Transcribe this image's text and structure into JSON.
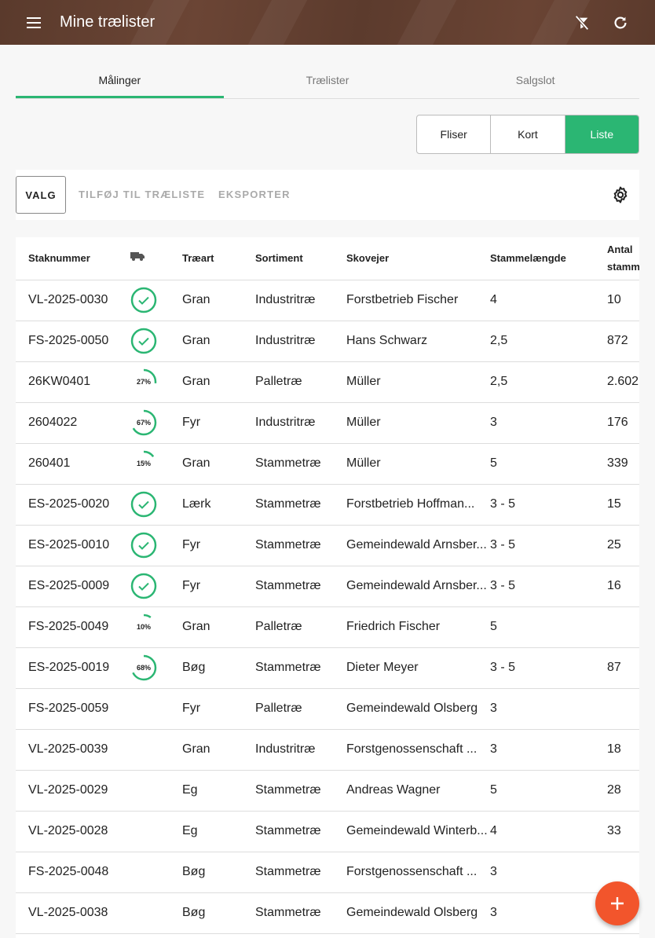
{
  "appbar": {
    "title": "Mine trælister",
    "menu_icon": "menu-icon",
    "filter_icon": "filter-off-icon",
    "refresh_icon": "refresh-icon"
  },
  "tabs": [
    {
      "label": "Målinger",
      "active": true
    },
    {
      "label": "Trælister",
      "active": false
    },
    {
      "label": "Salgslot",
      "active": false
    }
  ],
  "view_toggle": [
    {
      "label": "Fliser",
      "active": false
    },
    {
      "label": "Kort",
      "active": false
    },
    {
      "label": "Liste",
      "active": true
    }
  ],
  "toolbar": {
    "select_label": "VALG",
    "add_to_list_label": "TILFØJ TIL TRÆLISTE",
    "export_label": "EKSPORTER",
    "settings_icon": "gear-icon"
  },
  "table": {
    "headers": {
      "stack": "Staknummer",
      "transport_icon": "truck-icon",
      "species": "Træart",
      "assortment": "Sortiment",
      "owner": "Skovejer",
      "length": "Stammelængde",
      "count": "Antal stamm"
    },
    "rows": [
      {
        "stack": "VL-2025-0030",
        "status": "done",
        "progress": 100,
        "species": "Gran",
        "assortment": "Industritræ",
        "owner": "Forstbetrieb Fischer",
        "length": "4",
        "count": "10"
      },
      {
        "stack": "FS-2025-0050",
        "status": "done",
        "progress": 100,
        "species": "Gran",
        "assortment": "Industritræ",
        "owner": "Hans Schwarz",
        "length": "2,5",
        "count": "872"
      },
      {
        "stack": "26KW0401",
        "status": "progress",
        "progress": 27,
        "progress_label": "27%",
        "species": "Gran",
        "assortment": "Palletræ",
        "owner": "Müller",
        "length": "2,5",
        "count": "2.602"
      },
      {
        "stack": "2604022",
        "status": "progress",
        "progress": 67,
        "progress_label": "67%",
        "species": "Fyr",
        "assortment": "Industritræ",
        "owner": "Müller",
        "length": "3",
        "count": "176"
      },
      {
        "stack": "260401",
        "status": "progress",
        "progress": 15,
        "progress_label": "15%",
        "species": "Gran",
        "assortment": "Stammetræ",
        "owner": "Müller",
        "length": "5",
        "count": "339"
      },
      {
        "stack": "ES-2025-0020",
        "status": "done",
        "progress": 100,
        "species": "Lærk",
        "assortment": "Stammetræ",
        "owner": "Forstbetrieb Hoffman...",
        "length": "3 - 5",
        "count": "15"
      },
      {
        "stack": "ES-2025-0010",
        "status": "done",
        "progress": 100,
        "species": "Fyr",
        "assortment": "Stammetræ",
        "owner": "Gemeindewald Arnsber...",
        "length": "3 - 5",
        "count": "25"
      },
      {
        "stack": "ES-2025-0009",
        "status": "done",
        "progress": 100,
        "species": "Fyr",
        "assortment": "Stammetræ",
        "owner": "Gemeindewald Arnsber...",
        "length": "3 - 5",
        "count": "16"
      },
      {
        "stack": "FS-2025-0049",
        "status": "progress",
        "progress": 10,
        "progress_label": "10%",
        "species": "Gran",
        "assortment": "Palletræ",
        "owner": "Friedrich Fischer",
        "length": "5",
        "count": ""
      },
      {
        "stack": "ES-2025-0019",
        "status": "progress",
        "progress": 68,
        "progress_label": "68%",
        "species": "Bøg",
        "assortment": "Stammetræ",
        "owner": "Dieter Meyer",
        "length": "3 - 5",
        "count": "87"
      },
      {
        "stack": "FS-2025-0059",
        "status": "none",
        "progress": 0,
        "species": "Fyr",
        "assortment": "Palletræ",
        "owner": "Gemeindewald Olsberg",
        "length": "3",
        "count": ""
      },
      {
        "stack": "VL-2025-0039",
        "status": "none",
        "progress": 0,
        "species": "Gran",
        "assortment": "Industritræ",
        "owner": "Forstgenossenschaft ...",
        "length": "3",
        "count": "18"
      },
      {
        "stack": "VL-2025-0029",
        "status": "none",
        "progress": 0,
        "species": "Eg",
        "assortment": "Stammetræ",
        "owner": "Andreas Wagner",
        "length": "5",
        "count": "28"
      },
      {
        "stack": "VL-2025-0028",
        "status": "none",
        "progress": 0,
        "species": "Eg",
        "assortment": "Stammetræ",
        "owner": "Gemeindewald Winterb...",
        "length": "4",
        "count": "33"
      },
      {
        "stack": "FS-2025-0048",
        "status": "none",
        "progress": 0,
        "species": "Bøg",
        "assortment": "Stammetræ",
        "owner": "Forstgenossenschaft ...",
        "length": "3",
        "count": ""
      },
      {
        "stack": "VL-2025-0038",
        "status": "none",
        "progress": 0,
        "species": "Bøg",
        "assortment": "Stammetræ",
        "owner": "Gemeindewald Olsberg",
        "length": "3",
        "count": ""
      }
    ]
  },
  "fab": {
    "icon": "plus-icon"
  },
  "colors": {
    "accent": "#2bb673",
    "appbar": "#5e3d2e",
    "fab": "#f2552c"
  }
}
